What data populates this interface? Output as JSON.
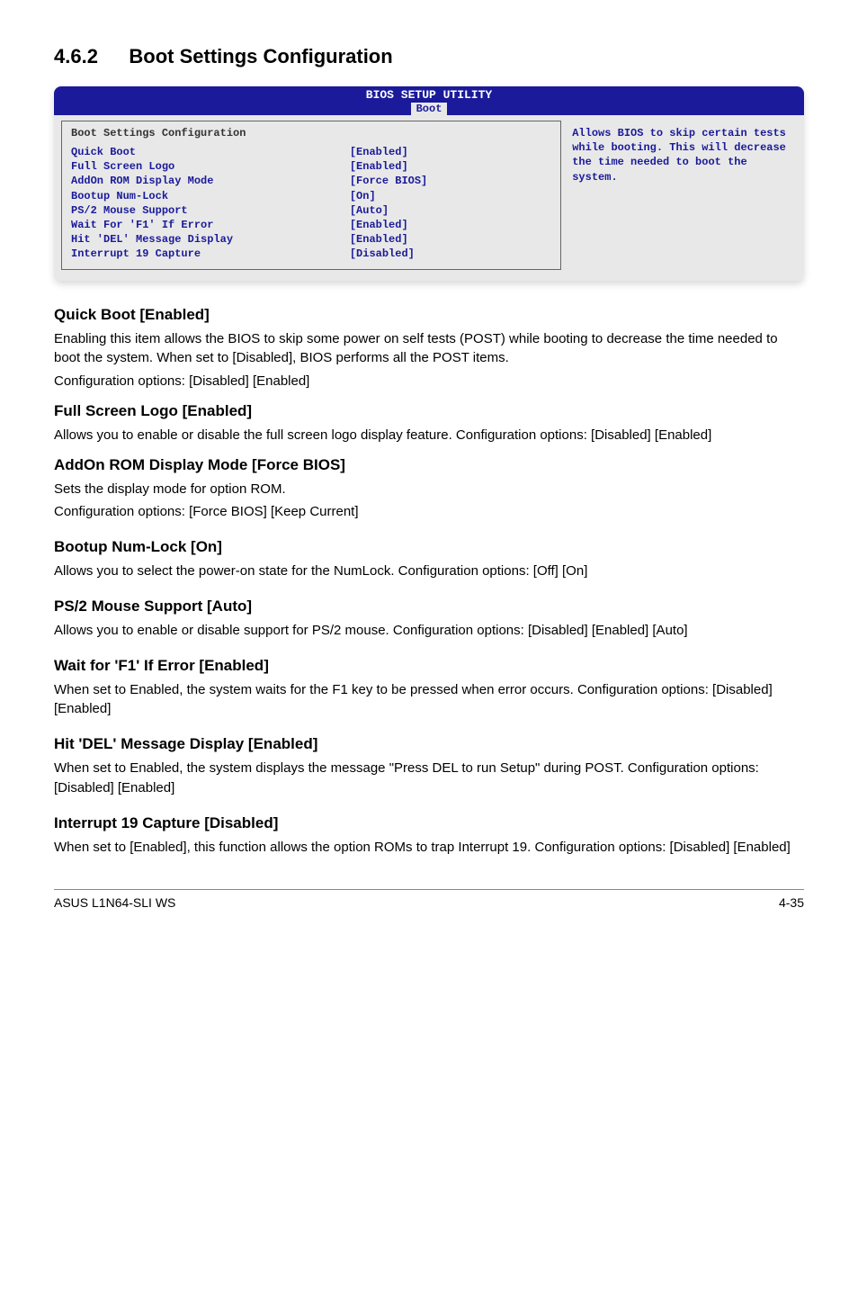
{
  "section": {
    "number": "4.6.2",
    "title": "Boot Settings Configuration"
  },
  "bios": {
    "header_title": "BIOS SETUP UTILITY",
    "tab": "Boot",
    "panel_title": "Boot Settings Configuration",
    "items": [
      {
        "label": "Quick Boot",
        "value": "[Enabled]"
      },
      {
        "label": "Full Screen Logo",
        "value": "[Enabled]"
      },
      {
        "label": "AddOn ROM Display Mode",
        "value": "[Force BIOS]"
      },
      {
        "label": "Bootup Num-Lock",
        "value": "[On]"
      },
      {
        "label": "PS/2 Mouse Support",
        "value": "[Auto]"
      },
      {
        "label": "Wait For 'F1' If Error",
        "value": "[Enabled]"
      },
      {
        "label": "Hit 'DEL' Message Display",
        "value": "[Enabled]"
      },
      {
        "label": "Interrupt 19 Capture",
        "value": "[Disabled]"
      }
    ],
    "help_text": "Allows BIOS to skip certain tests while booting. This will decrease the time needed to boot the system."
  },
  "subsections": [
    {
      "title": "Quick Boot [Enabled]",
      "paragraphs": [
        "Enabling this item allows the BIOS to skip some power on self tests (POST) while booting to decrease the time needed to boot the system. When set to [Disabled], BIOS performs all the POST items.",
        "Configuration options: [Disabled] [Enabled]"
      ]
    },
    {
      "title": "Full Screen Logo [Enabled]",
      "paragraphs": [
        "Allows you to enable or disable the full screen logo display feature. Configuration options: [Disabled] [Enabled]"
      ]
    },
    {
      "title": "AddOn ROM Display Mode [Force BIOS]",
      "paragraphs": [
        "Sets the display mode for option ROM.",
        "Configuration options: [Force BIOS] [Keep Current]"
      ]
    },
    {
      "title": "Bootup Num-Lock [On]",
      "paragraphs": [
        "Allows you to select the power-on state for the NumLock. Configuration options: [Off] [On]"
      ]
    },
    {
      "title": "PS/2 Mouse Support [Auto]",
      "paragraphs": [
        "Allows you to enable or disable support for PS/2 mouse. Configuration options: [Disabled] [Enabled] [Auto]"
      ]
    },
    {
      "title": "Wait for 'F1' If Error [Enabled]",
      "paragraphs": [
        "When set to Enabled, the system waits for the F1 key to be pressed when error occurs. Configuration options: [Disabled] [Enabled]"
      ]
    },
    {
      "title": "Hit 'DEL' Message Display [Enabled]",
      "paragraphs": [
        "When set to Enabled, the system displays the message \"Press DEL to run Setup\" during POST. Configuration options: [Disabled] [Enabled]"
      ]
    },
    {
      "title": "Interrupt 19 Capture [Disabled]",
      "paragraphs": [
        "When set to [Enabled], this function allows the option ROMs to trap Interrupt 19. Configuration options: [Disabled] [Enabled]"
      ]
    }
  ],
  "footer": {
    "left": "ASUS L1N64-SLI WS",
    "right": "4-35"
  }
}
